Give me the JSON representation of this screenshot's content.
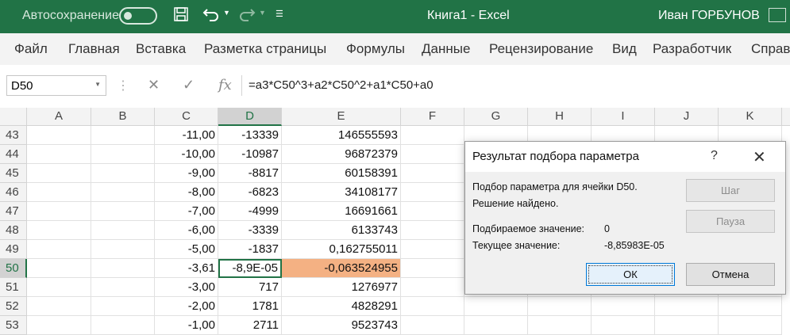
{
  "titlebar": {
    "autosave_label": "Автосохранение",
    "save_icon": "save-icon",
    "undo_icon": "undo-icon",
    "redo_icon": "redo-icon",
    "qat_more_icon": "qat-more-icon",
    "document_title": "Книга1  -  Excel",
    "user_name": "Иван ГОРБУНОВ",
    "brand_color": "#217346"
  },
  "ribbon": {
    "tabs": [
      "Файл",
      "Главная",
      "Вставка",
      "Разметка страницы",
      "Формулы",
      "Данные",
      "Рецензирование",
      "Вид",
      "Разработчик",
      "Справ"
    ]
  },
  "formula_bar": {
    "name_box": "D50",
    "cancel_icon": "✕",
    "enter_icon": "✓",
    "fx_icon": "fx",
    "formula": "=a3*C50^3+a2*C50^2+a1*C50+a0"
  },
  "sheet": {
    "columns": [
      "A",
      "B",
      "C",
      "D",
      "E",
      "F",
      "G",
      "H",
      "I",
      "J",
      "K"
    ],
    "rows": [
      {
        "num": "43",
        "C": "-11,00",
        "D": "-13339",
        "E": "146555593"
      },
      {
        "num": "44",
        "C": "-10,00",
        "D": "-10987",
        "E": "96872379"
      },
      {
        "num": "45",
        "C": "-9,00",
        "D": "-8817",
        "E": "60158391"
      },
      {
        "num": "46",
        "C": "-8,00",
        "D": "-6823",
        "E": "34108177"
      },
      {
        "num": "47",
        "C": "-7,00",
        "D": "-4999",
        "E": "16691661"
      },
      {
        "num": "48",
        "C": "-6,00",
        "D": "-3339",
        "E": "6133743"
      },
      {
        "num": "49",
        "C": "-5,00",
        "D": "-1837",
        "E": "0,162755011"
      },
      {
        "num": "50",
        "C": "-3,61",
        "D": "-8,9E-05",
        "E": "-0,063524955"
      },
      {
        "num": "51",
        "C": "-3,00",
        "D": "717",
        "E": "1276977"
      },
      {
        "num": "52",
        "C": "-2,00",
        "D": "1781",
        "E": "4828291"
      },
      {
        "num": "53",
        "C": "-1,00",
        "D": "2711",
        "E": "9523743"
      }
    ],
    "highlight_color": "#f4b183"
  },
  "dialog": {
    "title": "Результат подбора параметра",
    "help": "?",
    "close": "✕",
    "line1": "Подбор параметра для ячейки D50.",
    "line2": "Решение найдено.",
    "target_label": "Подбираемое значение:",
    "target_value": "0",
    "current_label": "Текущее значение:",
    "current_value": "-8,85983E-05",
    "step_button": "Шаг",
    "pause_button": "Пауза",
    "ok_button": "ОК",
    "cancel_button": "Отмена"
  }
}
